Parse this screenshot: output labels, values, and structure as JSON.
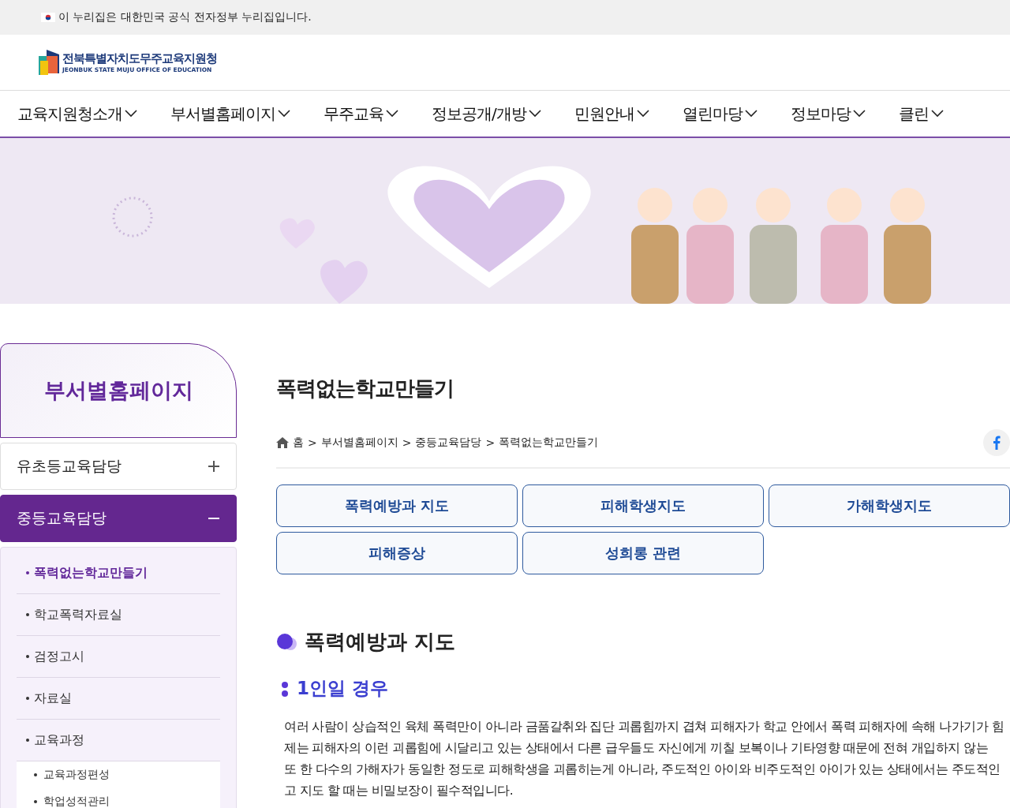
{
  "gov_banner": {
    "text": "이 누리집은 대한민국 공식 전자정부 누리집입니다."
  },
  "logo": {
    "name": "전북특별자치도무주교육지원청",
    "subtitle": "JEONBUK STATE MUJU OFFICE OF EDUCATION"
  },
  "nav": [
    {
      "label": "교육지원청소개"
    },
    {
      "label": "부서별홈페이지"
    },
    {
      "label": "무주교육"
    },
    {
      "label": "정보공개/개방"
    },
    {
      "label": "민원안내"
    },
    {
      "label": "열린마당"
    },
    {
      "label": "정보마당"
    },
    {
      "label": "클린"
    }
  ],
  "sidebar": {
    "title": "부서별홈페이지",
    "groups": [
      {
        "label": "유초등교육담당",
        "expanded": false
      },
      {
        "label": "중등교육담당",
        "expanded": true,
        "items": [
          {
            "label": "폭력없는학교만들기",
            "selected": true
          },
          {
            "label": "학교폭력자료실",
            "selected": false
          },
          {
            "label": "검정고시",
            "selected": false
          },
          {
            "label": "자료실",
            "selected": false
          },
          {
            "label": "교육과정",
            "selected": false,
            "children": [
              {
                "label": "교육과정편성"
              },
              {
                "label": "학업성적관리"
              }
            ]
          }
        ]
      }
    ]
  },
  "page": {
    "title": "폭력없는학교만들기",
    "breadcrumb_separator": ">",
    "breadcrumb": [
      "홈",
      "부서별홈페이지",
      "중등교육담당",
      "폭력없는학교만들기"
    ],
    "tabs": [
      {
        "label": "폭력예방과 지도",
        "selected": false
      },
      {
        "label": "피해학생지도",
        "selected": false
      },
      {
        "label": "가해학생지도",
        "selected": false
      },
      {
        "label": "피해증상",
        "selected": false
      },
      {
        "label": "성희롱 관련",
        "selected": false
      }
    ],
    "section_title": "폭력예방과 지도",
    "subsection_title": "1인일 경우",
    "paragraph_lines": [
      "여러 사람이 상습적인 육체 폭력만이 아니라 금품갈취와 집단 괴롭힘까지 겹쳐 피해자가 학교 안에서 폭력 피해자에 속해 나가기가 힘",
      "제는 피해자의 이런 괴롭힘에 시달리고 있는 상태에서 다른 급우들도 자신에게 끼칠 보복이나 기타영향 때문에 전혀 개입하지 않는",
      "또 한 다수의 가해자가 동일한 정도로 피해학생을 괴롭히는게 아니라, 주도적인 아이와 비주도적인 아이가 있는 상태에서는 주도적인",
      "고 지도 할 때는 비밀보장이 필수적입니다."
    ]
  }
}
